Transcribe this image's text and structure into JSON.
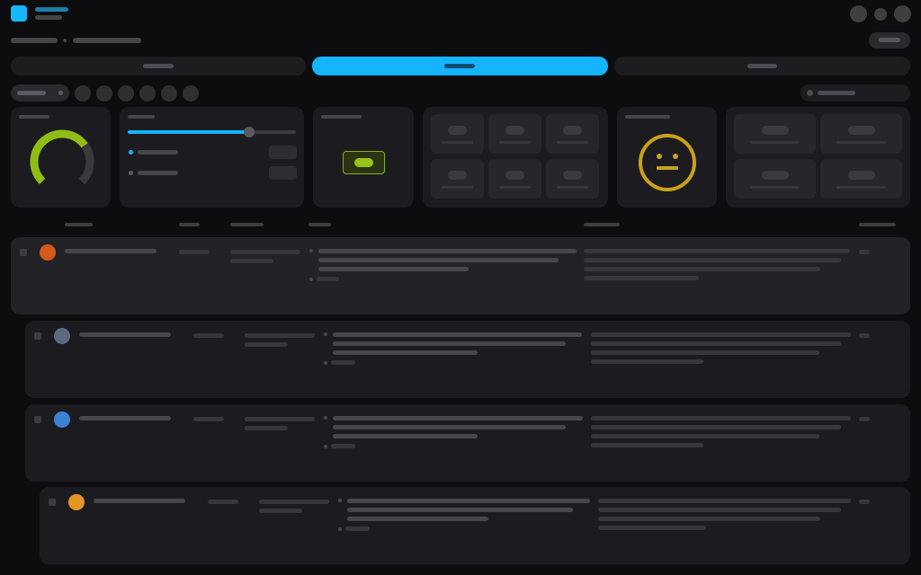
{
  "colors": {
    "accent": "#14b4ff",
    "lime": "#8fbd14",
    "gauge_track": "#3a3a3e",
    "face": "#c9a21a",
    "avatar_colors": [
      "#d4591a",
      "#5b6c82",
      "#3b82d4",
      "#e39624"
    ]
  },
  "icons": {
    "logo": "app-logo-icon",
    "header_actions": [
      "profile-icon",
      "notification-icon",
      "settings-icon"
    ],
    "search": "search-icon",
    "status": "neutral-face-icon"
  },
  "tabs": {
    "count": 3,
    "active_index": 1
  },
  "filters": {
    "chip_count": 6
  },
  "stats": {
    "gauge_level": 0.7,
    "slider_level": 0.72,
    "selected_option_index": 0,
    "status_face": "neutral"
  },
  "table": {
    "row_count": 4,
    "row_indent_levels": [
      0,
      1,
      1,
      2
    ]
  }
}
